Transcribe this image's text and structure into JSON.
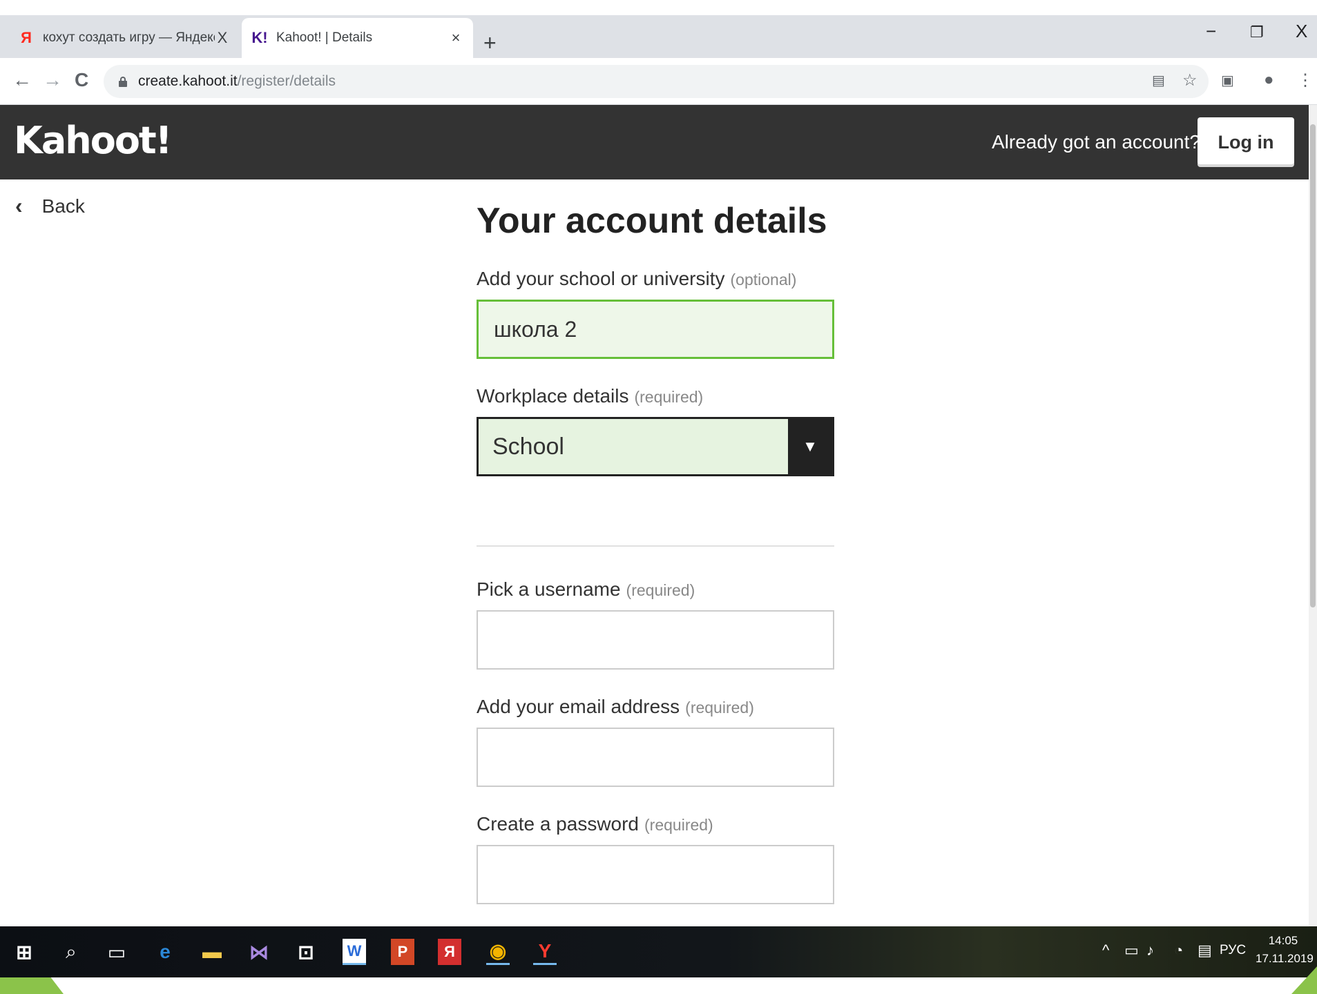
{
  "browser": {
    "tabs": [
      {
        "favicon": "Я",
        "title": "кохут создать игру — Яндекс: н",
        "close": "X"
      },
      {
        "favicon": "K!",
        "title": "Kahoot! | Details",
        "close": "×"
      }
    ],
    "new_tab": "+",
    "window_controls": {
      "minimize": "−",
      "restore": "❐",
      "close": "X"
    },
    "nav": {
      "back": "←",
      "forward": "→",
      "reload": "C"
    },
    "url_host": "create.kahoot.it",
    "url_path": "/register/details",
    "menu": "⋮"
  },
  "header": {
    "logo": "Kahoot!",
    "already_text": "Already got an account?",
    "login_label": "Log in"
  },
  "back_label": "Back",
  "form": {
    "title": "Your account details",
    "school": {
      "label": "Add your school or university",
      "hint": "(optional)",
      "value": "школа 2"
    },
    "workplace": {
      "label": "Workplace details",
      "hint": "(required)",
      "value": "School",
      "arrow": "▼"
    },
    "username": {
      "label": "Pick a username",
      "hint": "(required)",
      "value": ""
    },
    "email": {
      "label": "Add your email address",
      "hint": "(required)",
      "value": ""
    },
    "password": {
      "label": "Create a password",
      "hint": "(required)",
      "value": ""
    }
  },
  "taskbar": {
    "tray_lang": "РУС",
    "time": "14:05",
    "date": "17.11.2019"
  }
}
